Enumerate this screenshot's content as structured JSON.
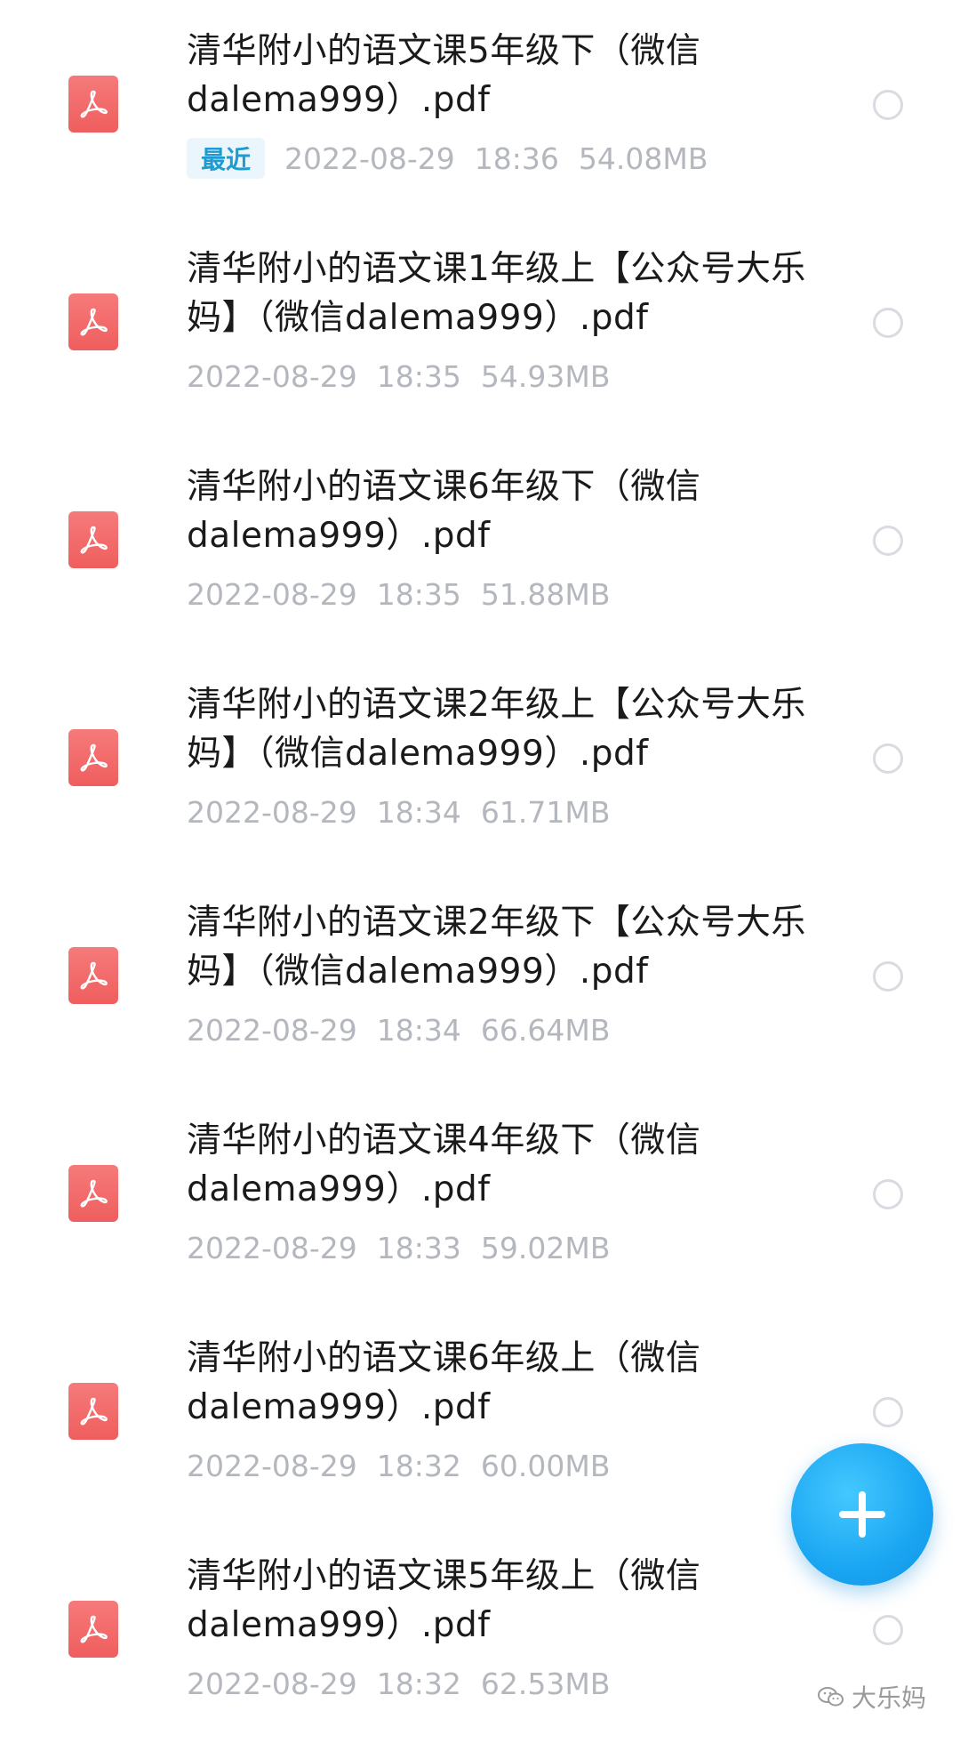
{
  "files": [
    {
      "name": "清华附小的语文课5年级下（微信dalema999）.pdf",
      "recent": "最近",
      "date": "2022-08-29",
      "time": "18:36",
      "size": "54.08MB"
    },
    {
      "name": "清华附小的语文课1年级上【公众号大乐妈】（微信dalema999）.pdf",
      "recent": "",
      "date": "2022-08-29",
      "time": "18:35",
      "size": "54.93MB"
    },
    {
      "name": "清华附小的语文课6年级下（微信dalema999）.pdf",
      "recent": "",
      "date": "2022-08-29",
      "time": "18:35",
      "size": "51.88MB"
    },
    {
      "name": "清华附小的语文课2年级上【公众号大乐妈】（微信dalema999）.pdf",
      "recent": "",
      "date": "2022-08-29",
      "time": "18:34",
      "size": "61.71MB"
    },
    {
      "name": "清华附小的语文课2年级下【公众号大乐妈】（微信dalema999）.pdf",
      "recent": "",
      "date": "2022-08-29",
      "time": "18:34",
      "size": "66.64MB"
    },
    {
      "name": "清华附小的语文课4年级下（微信dalema999）.pdf",
      "recent": "",
      "date": "2022-08-29",
      "time": "18:33",
      "size": "59.02MB"
    },
    {
      "name": "清华附小的语文课6年级上（微信dalema999）.pdf",
      "recent": "",
      "date": "2022-08-29",
      "time": "18:32",
      "size": "60.00MB"
    },
    {
      "name": "清华附小的语文课5年级上（微信dalema999）.pdf",
      "recent": "",
      "date": "2022-08-29",
      "time": "18:32",
      "size": "62.53MB"
    }
  ],
  "icons": {
    "file": "pdf-icon",
    "select": "radio-icon",
    "fab": "plus-icon",
    "watermark": "wechat-icon"
  },
  "colors": {
    "pdf_icon": "#ef5e5e",
    "fab": "#1aa6f2",
    "recent_badge_text": "#1e9bd0",
    "meta_text": "#b4b7bd"
  },
  "watermark": {
    "text": "大乐妈"
  }
}
